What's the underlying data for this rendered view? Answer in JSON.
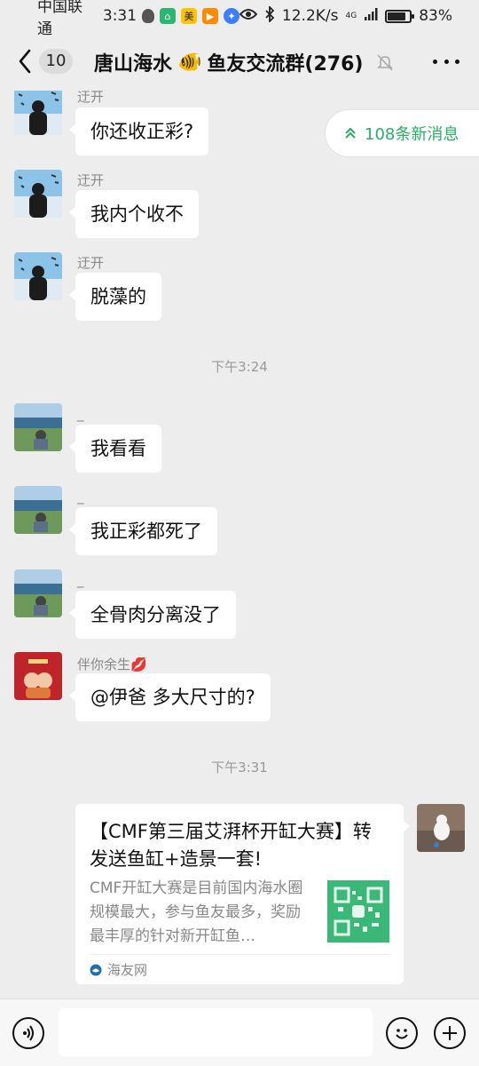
{
  "status_bar": {
    "carrier": "中国联通",
    "time": "3:31",
    "net_speed": "12.2K/s",
    "signal": "4G",
    "battery": "83%",
    "battery_level": 0.83,
    "icons": [
      "shield-icon",
      "app-icon-green",
      "app-icon-mei",
      "app-icon-video",
      "app-icon-blue",
      "eye-icon",
      "bluetooth-icon",
      "signal-icon",
      "battery-icon"
    ]
  },
  "header": {
    "unread": "10",
    "title_part1": "唐山海水",
    "title_emoji": "🐠",
    "title_part2": "鱼友交流群(276)"
  },
  "new_messages": "108条新消息",
  "messages": [
    {
      "sender": "迂开",
      "text": "你还收正彩?"
    },
    {
      "sender": "迂开",
      "text": "我内个收不"
    },
    {
      "sender": "迂开",
      "text": "脱藻的"
    },
    {
      "sender": "_",
      "text": "我看看"
    },
    {
      "sender": "_",
      "text": "我正彩都死了"
    },
    {
      "sender": "_",
      "text": "全骨肉分离没了"
    },
    {
      "sender": "伴你余生",
      "sender_emoji": "💋",
      "text": "@伊爸  多大尺寸的?"
    }
  ],
  "times": [
    "下午3:24",
    "下午3:31"
  ],
  "card": {
    "title": "【CMF第三届艾湃杯开缸大赛】转发送鱼缸+造景一套!",
    "description": "CMF开缸大赛是目前国内海水圈规模最大，参与鱼友最多，奖励最丰厚的针对新开缸鱼…",
    "source": "海友网"
  },
  "colors": {
    "background": "#ededed",
    "bubble": "#ffffff",
    "accent_green": "#2aae67"
  }
}
